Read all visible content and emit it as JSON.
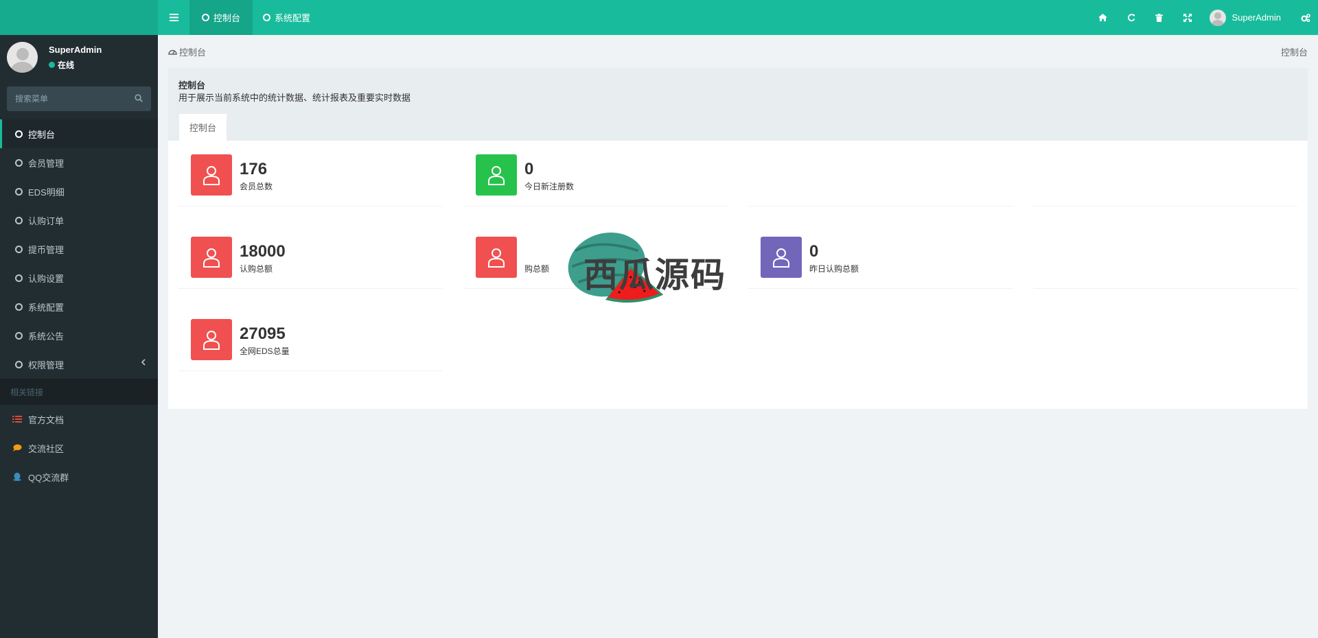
{
  "header": {
    "tabs": [
      {
        "label": "控制台"
      },
      {
        "label": "系统配置"
      }
    ],
    "user_name": "SuperAdmin"
  },
  "sidebar": {
    "user": {
      "name": "SuperAdmin",
      "status": "在线"
    },
    "search_placeholder": "搜索菜单",
    "items": [
      {
        "label": "控制台"
      },
      {
        "label": "会员管理"
      },
      {
        "label": "EDS明细"
      },
      {
        "label": "认购订单"
      },
      {
        "label": "提币管理"
      },
      {
        "label": "认购设置"
      },
      {
        "label": "系统配置"
      },
      {
        "label": "系统公告"
      },
      {
        "label": "权限管理"
      }
    ],
    "links_header": "相关链接",
    "links": [
      {
        "label": "官方文档",
        "icon": "list-icon",
        "color": "#dd4b39"
      },
      {
        "label": "交流社区",
        "icon": "comment-icon",
        "color": "#f39c12"
      },
      {
        "label": "QQ交流群",
        "icon": "qq-icon",
        "color": "#3c8dbc"
      }
    ],
    "active_color": "#18bc9c"
  },
  "breadcrumb": {
    "label": "控制台",
    "right": "控制台"
  },
  "panel": {
    "title": "控制台",
    "description": "用于展示当前系统中的统计数据、统计报表及重要实时数据",
    "tab": "控制台"
  },
  "stats": [
    {
      "value": "176",
      "label": "会员总数",
      "color": "#f05050"
    },
    {
      "value": "0",
      "label": "今日新注册数",
      "color": "#27c24c"
    },
    {
      "value": "18000",
      "label": "认购总额",
      "color": "#f05050"
    },
    {
      "value": "",
      "label": "购总额",
      "color": "#f05050"
    },
    {
      "value": "0",
      "label": "昨日认购总额",
      "color": "#7266ba"
    },
    {
      "value": "27095",
      "label": "全网EDS总量",
      "color": "#f05050"
    }
  ],
  "watermark": {
    "text": "西瓜源码"
  },
  "theme": {
    "primary": "#18bc9c",
    "sidebar": "#222d32"
  }
}
